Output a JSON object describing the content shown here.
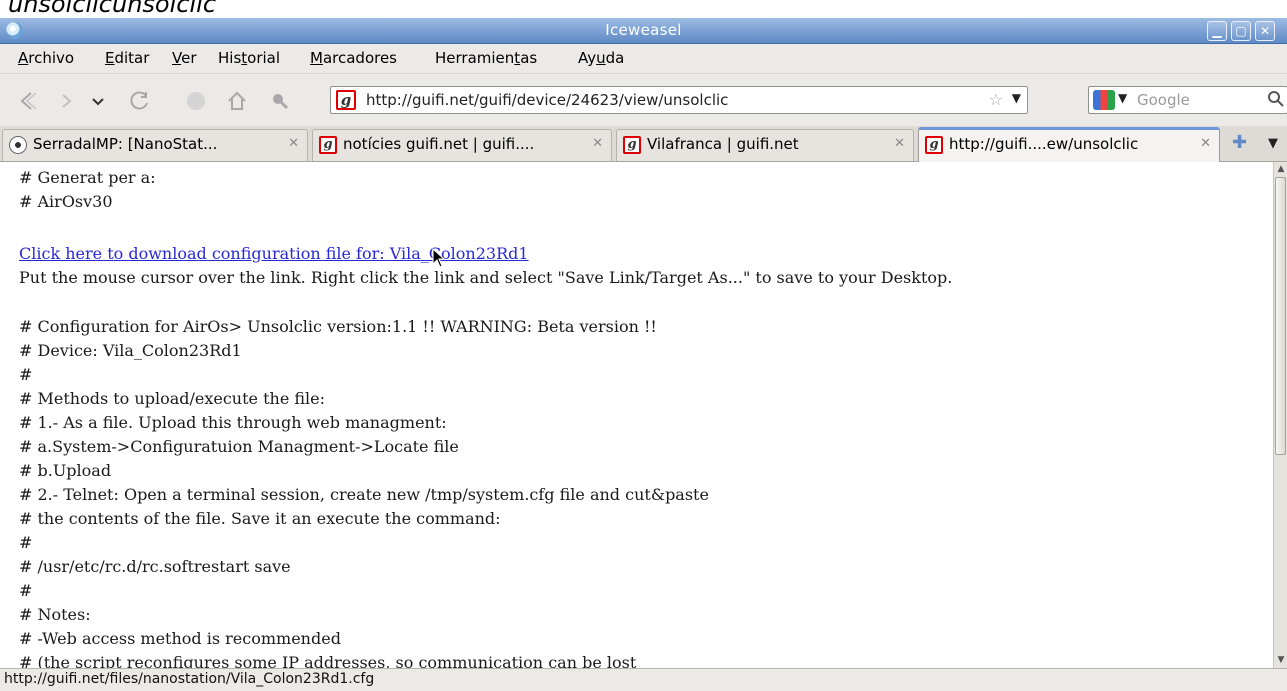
{
  "top_cut_text": "unsolclicunsolclic",
  "window": {
    "title": "Iceweasel",
    "min_symbol": "▁",
    "max_symbol": "▢",
    "close_symbol": "✕"
  },
  "menu": [
    {
      "pre": "",
      "key": "A",
      "post": "rchivo"
    },
    {
      "pre": "",
      "key": "E",
      "post": "ditar"
    },
    {
      "pre": "",
      "key": "V",
      "post": "er"
    },
    {
      "pre": "His",
      "key": "t",
      "post": "orial"
    },
    {
      "pre": "",
      "key": "M",
      "post": "arcadores"
    },
    {
      "pre": "Herramien",
      "key": "t",
      "post": "as"
    },
    {
      "pre": "Ay",
      "key": "u",
      "post": "da"
    }
  ],
  "nav": {
    "url": "http://guifi.net/guifi/device/24623/view/unsolclic",
    "site_icon_letter": "g",
    "search_placeholder": "Google",
    "icons": [
      "back-icon",
      "forward-icon",
      "history-dropdown-icon",
      "reload-icon",
      "stop-icon",
      "home-icon",
      "plugin-icon",
      "bookmark-star-icon",
      "search-icon"
    ]
  },
  "tabs": [
    {
      "label": "SerradalMP: [NanoStat...",
      "favicon": "globe",
      "active": false
    },
    {
      "label": "notícies guifi.net | guifi....",
      "favicon": "g",
      "active": false
    },
    {
      "label": "Vilafranca | guifi.net",
      "favicon": "g",
      "active": false
    },
    {
      "label": "http://guifi....ew/unsolclic",
      "favicon": "g",
      "active": true
    }
  ],
  "tab_close_symbol": "✕",
  "content": {
    "generat": "# Generat per a:",
    "airos": "# AirOsv30",
    "download_link": "Click here to download configuration file for: Vila_Colon23Rd1",
    "instructions": "Put the mouse cursor over the link. Right click the link and select \"Save Link/Target As...\" to save to your Desktop.",
    "lines": [
      "# Configuration for AirOs> Unsolclic version:1.1 !! WARNING: Beta version !!",
      "# Device: Vila_Colon23Rd1",
      "#",
      "# Methods to upload/execute the file:",
      "# 1.- As a file. Upload this through web managment:",
      "# a.System->Configuratuion Managment->Locate file",
      "# b.Upload",
      "# 2.- Telnet: Open a terminal session, create new /tmp/system.cfg file and cut&paste",
      "# the contents of the file. Save it an execute the command:",
      "#",
      "# /usr/etc/rc.d/rc.softrestart save",
      "#",
      "# Notes:",
      "# -Web access method is recommended",
      "# (the script reconfigures some IP addresses, so communication can be lost"
    ]
  },
  "status": "http://guifi.net/files/nanostation/Vila_Colon23Rd1.cfg"
}
